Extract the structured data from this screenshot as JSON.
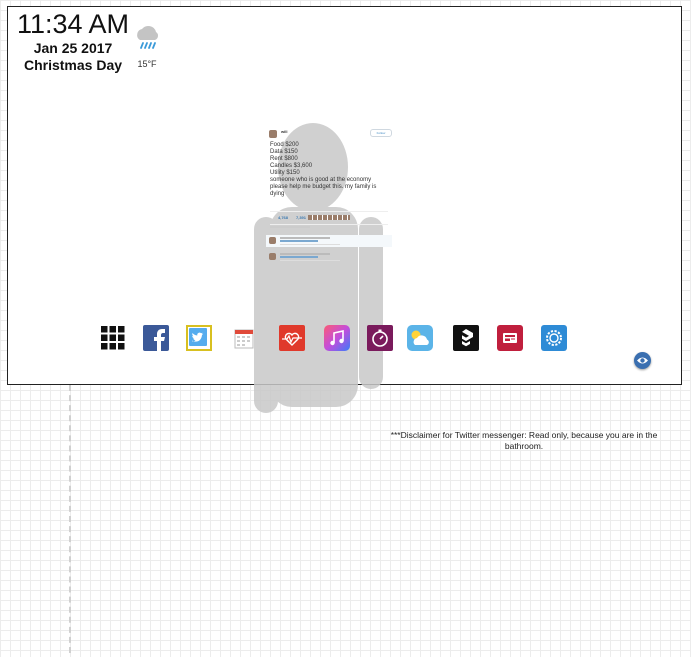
{
  "clock": {
    "time": "11:34 AM",
    "date": "Jan 25 2017",
    "holiday": "Christmas Day"
  },
  "weather": {
    "icon": "rain-cloud-icon",
    "temperature": "15°F"
  },
  "tweet": {
    "author": "will",
    "follow_label": "Follow",
    "lines": [
      "Food $200",
      "Data $150",
      "Rent $800",
      "Candles $3,600",
      "Utility $150",
      "someone who is good at the economy",
      "please help me budget this. my family is",
      "dying"
    ],
    "retweets": "4,768",
    "likes": "7,391"
  },
  "dock": {
    "apps": [
      {
        "name": "app-grid",
        "icon": "grid-icon"
      },
      {
        "name": "facebook",
        "icon": "facebook-icon"
      },
      {
        "name": "twitter",
        "icon": "twitter-icon",
        "selected": true
      },
      {
        "name": "calendar",
        "icon": "calendar-icon"
      },
      {
        "name": "health",
        "icon": "heart-rate-icon"
      },
      {
        "name": "music",
        "icon": "music-note-icon"
      },
      {
        "name": "timer",
        "icon": "stopwatch-icon"
      },
      {
        "name": "weather",
        "icon": "weather-icon"
      },
      {
        "name": "9gag",
        "icon": "9gag-icon"
      },
      {
        "name": "news",
        "icon": "news-icon"
      },
      {
        "name": "settings",
        "icon": "gear-icon"
      }
    ],
    "selected_border_color": "#d8c020"
  },
  "eye_button": {
    "icon": "eye-icon"
  },
  "disclaimer": "***Disclaimer for Twitter messenger: Read only, because you are in the bathroom."
}
